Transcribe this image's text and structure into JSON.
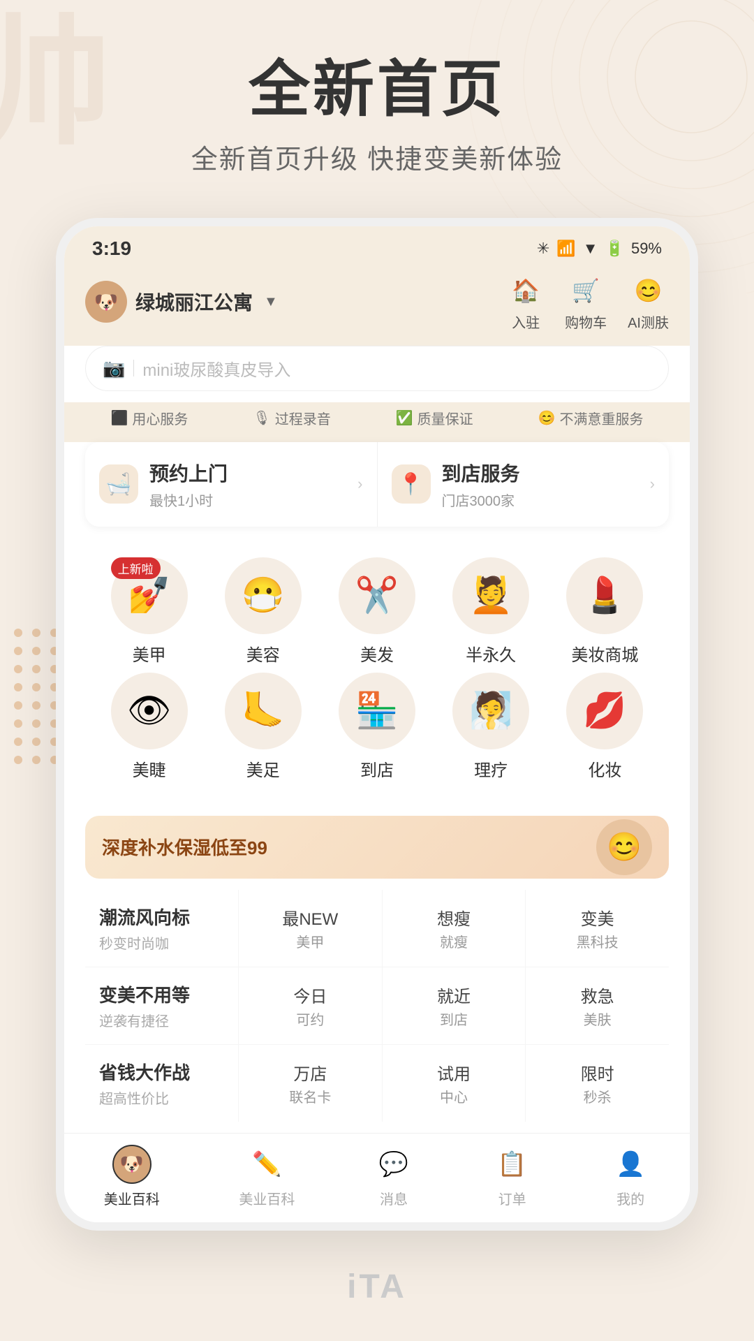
{
  "page": {
    "background_color": "#f5ede4"
  },
  "hero": {
    "title": "全新首页",
    "subtitle": "全新首页升级  快捷变美新体验"
  },
  "phone": {
    "status_bar": {
      "time": "3:19",
      "battery": "59%"
    },
    "header": {
      "location": "绿城丽江公寓",
      "icons": [
        {
          "icon": "🏠",
          "label": "入驻"
        },
        {
          "icon": "🛒",
          "label": "购物车"
        },
        {
          "icon": "😊",
          "label": "AI测肤"
        }
      ]
    },
    "search": {
      "placeholder": "mini玻尿酸真皮导入"
    },
    "service_tags": [
      {
        "icon": "⬛",
        "label": "用心服务"
      },
      {
        "icon": "🎙",
        "label": "过程录音"
      },
      {
        "icon": "✅",
        "label": "质量保证"
      },
      {
        "icon": "😊",
        "label": "不满意重服务"
      }
    ],
    "service_buttons": [
      {
        "icon": "🏠",
        "main": "预约上门",
        "sub": "最快1小时"
      },
      {
        "icon": "📍",
        "main": "到店服务",
        "sub": "门店3000家"
      }
    ],
    "categories": [
      [
        {
          "icon": "💅",
          "label": "美甲",
          "new": true
        },
        {
          "icon": "😷",
          "label": "美容",
          "new": false
        },
        {
          "icon": "✂️",
          "label": "美发",
          "new": false
        },
        {
          "icon": "💆",
          "label": "半永久",
          "new": false
        },
        {
          "icon": "💄",
          "label": "美妆商城",
          "new": false
        }
      ],
      [
        {
          "icon": "👁",
          "label": "美睫",
          "new": false
        },
        {
          "icon": "🦶",
          "label": "美足",
          "new": false
        },
        {
          "icon": "🏪",
          "label": "到店",
          "new": false
        },
        {
          "icon": "💆",
          "label": "理疗",
          "new": false
        },
        {
          "icon": "💋",
          "label": "化妆",
          "new": false
        }
      ]
    ],
    "new_badge_label": "上新啦",
    "banner": {
      "text": "深度补水保湿低至99"
    },
    "menu_grid": [
      {
        "header": {
          "title": "潮流风向标",
          "subtitle": "秒变时尚咖"
        },
        "cells": [
          {
            "title": "最NEW",
            "sub": "美甲"
          },
          {
            "title": "想瘦",
            "sub": "就瘦"
          },
          {
            "title": "变美",
            "sub": "黑科技"
          }
        ]
      },
      {
        "header": {
          "title": "变美不用等",
          "subtitle": "逆袭有捷径"
        },
        "cells": [
          {
            "title": "今日",
            "sub": "可约"
          },
          {
            "title": "就近",
            "sub": "到店"
          },
          {
            "title": "救急",
            "sub": "美肤"
          }
        ]
      },
      {
        "header": {
          "title": "省钱大作战",
          "subtitle": "超高性价比"
        },
        "cells": [
          {
            "title": "万店",
            "sub": "联名卡"
          },
          {
            "title": "试用",
            "sub": "中心"
          },
          {
            "title": "限时",
            "sub": "秒杀"
          }
        ]
      }
    ],
    "bottom_nav": [
      {
        "icon": "🐶",
        "label": "美业百科",
        "active": true,
        "is_avatar": true
      },
      {
        "icon": "✏️",
        "label": "美业百科",
        "active": false
      },
      {
        "icon": "💬",
        "label": "消息",
        "active": false
      },
      {
        "icon": "📋",
        "label": "订单",
        "active": false
      },
      {
        "icon": "👤",
        "label": "我的",
        "active": false
      }
    ]
  },
  "bottom_label": "iTA"
}
